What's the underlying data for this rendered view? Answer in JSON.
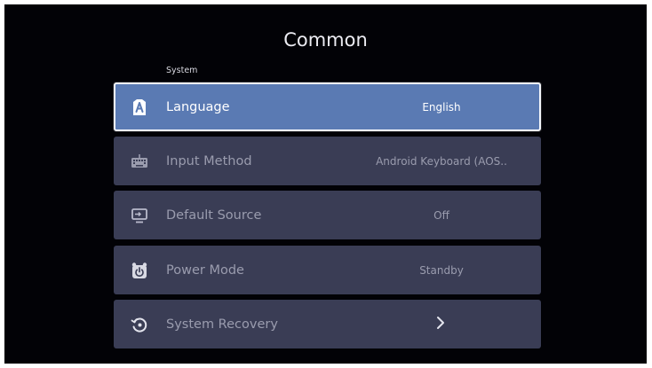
{
  "page": {
    "title": "Common"
  },
  "section": {
    "label": "System"
  },
  "rows": [
    {
      "label": "Language",
      "value": "English",
      "icon": "language-icon"
    },
    {
      "label": "Input Method",
      "value": "Android Keyboard (AOS..",
      "icon": "keyboard-icon"
    },
    {
      "label": "Default Source",
      "value": "Off",
      "icon": "monitor-input-icon"
    },
    {
      "label": "Power Mode",
      "value": "Standby",
      "icon": "power-alarm-icon"
    },
    {
      "label": "System Recovery",
      "value": "",
      "icon": "recovery-icon"
    }
  ],
  "focused_row": "Language",
  "colors": {
    "background": "#020206",
    "row": "#3a3d55",
    "row_focused": "#5a7ab3",
    "text_dim": "#9a9cae",
    "text_bright": "#ffffff"
  }
}
